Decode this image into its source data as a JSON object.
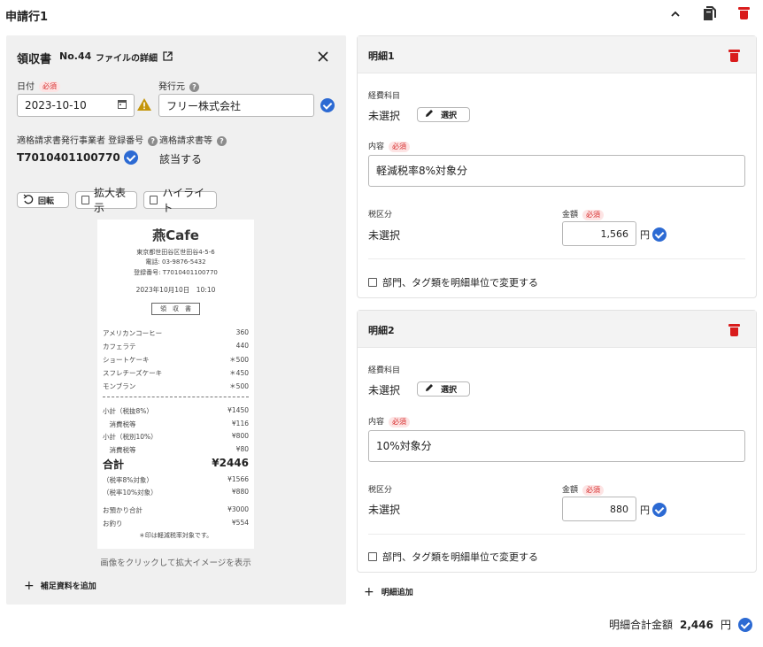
{
  "header": {
    "title": "申請行1"
  },
  "receipt_panel": {
    "title": "領収書",
    "number": "No.44",
    "file_detail_link": "ファイルの詳細",
    "date_label": "日付",
    "required": "必須",
    "date_value": "2023-10-10",
    "issuer_label": "発行元",
    "issuer_value": "フリー株式会社",
    "reg_label": "適格請求書発行事業者 登録番号",
    "reg_value": "T7010401100770",
    "qualified_label": "適格請求書等",
    "qualified_value": "該当する",
    "rotate_button": "回転",
    "zoom_label": "拡大表示",
    "highlight_label": "ハイライト",
    "image_hint": "画像をクリックして拡大イメージを表示",
    "add_supplement": "補足資料を追加"
  },
  "receipt": {
    "shop": "燕Cafe",
    "address": "東京都世田谷区世田谷4-5-6",
    "phone": "電話: 03-9876-5432",
    "registration": "登録番号: T7010401100770",
    "datetime": "2023年10月10日　10:10",
    "stamp": "領　収　書",
    "items": [
      {
        "name": "アメリカンコーヒー",
        "price": "360"
      },
      {
        "name": "カフェラテ",
        "price": "440"
      },
      {
        "name": "ショートケーキ",
        "price": "＊500"
      },
      {
        "name": "スフレチーズケーキ",
        "price": "＊450"
      },
      {
        "name": "モンブラン",
        "price": "＊500"
      }
    ],
    "subtotals": [
      {
        "name": "小計（税抜8%）",
        "price": "¥1450"
      },
      {
        "name": "　消費税等",
        "price": "¥116"
      },
      {
        "name": "小計（税別10%）",
        "price": "¥800"
      },
      {
        "name": "　消費税等",
        "price": "¥80"
      }
    ],
    "total_label": "合計",
    "total_value": "¥2446",
    "breakdown": [
      {
        "name": "（税率8%対象）",
        "price": "¥1566"
      },
      {
        "name": "（税率10%対象）",
        "price": "¥880"
      }
    ],
    "paid_label": "お預かり合計",
    "paid_value": "¥3000",
    "change_label": "お釣り",
    "change_value": "¥554",
    "note": "＊印は軽減税率対象です。"
  },
  "details": [
    {
      "title": "明細1",
      "account_label": "経費科目",
      "account_value": "未選択",
      "select_button": "選択",
      "content_label": "内容",
      "content_value": "軽減税率8%対象分",
      "tax_label": "税区分",
      "tax_value": "未選択",
      "amount_label": "金額",
      "amount_value": "1,566",
      "yen": "円",
      "dept_label": "部門、タグ類を明細単位で変更する"
    },
    {
      "title": "明細2",
      "account_label": "経費科目",
      "account_value": "未選択",
      "select_button": "選択",
      "content_label": "内容",
      "content_value": "10%対象分",
      "tax_label": "税区分",
      "tax_value": "未選択",
      "amount_label": "金額",
      "amount_value": "880",
      "yen": "円",
      "dept_label": "部門、タグ類を明細単位で変更する"
    }
  ],
  "add_detail": "明細追加",
  "footer": {
    "total_label": "明細合計金額",
    "total_value": "2,446",
    "yen": "円"
  },
  "colors": {
    "accent": "#2c6ad3",
    "danger": "#d91c1c",
    "required_bg": "#fde4e4",
    "panel_bg": "#f0f0f0"
  }
}
